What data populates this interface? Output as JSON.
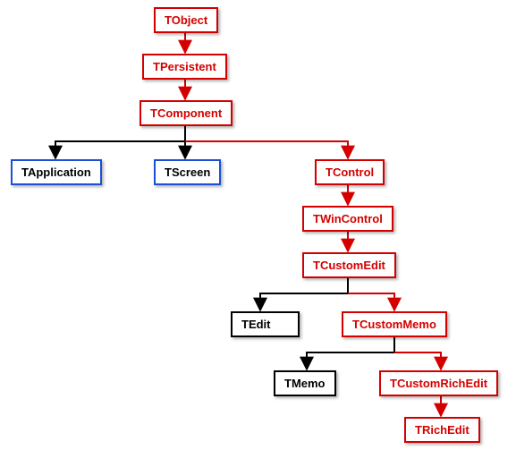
{
  "diagram": {
    "type": "class-hierarchy",
    "root": "TObject",
    "main_path": [
      "TObject",
      "TPersistent",
      "TComponent",
      "TControl",
      "TWinControl",
      "TCustomEdit",
      "TCustomMemo",
      "TCustomRichEdit",
      "TRichEdit"
    ],
    "nodes": {
      "tobject": {
        "label": "TObject",
        "style": "red"
      },
      "tpersistent": {
        "label": "TPersistent",
        "style": "red"
      },
      "tcomponent": {
        "label": "TComponent",
        "style": "red"
      },
      "tapplication": {
        "label": "TApplication",
        "style": "blue"
      },
      "tscreen": {
        "label": "TScreen",
        "style": "blue"
      },
      "tcontrol": {
        "label": "TControl",
        "style": "red"
      },
      "twincontrol": {
        "label": "TWinControl",
        "style": "red"
      },
      "tcustomedit": {
        "label": "TCustomEdit",
        "style": "red"
      },
      "tedit": {
        "label": "TEdit",
        "style": "black"
      },
      "tcustommemo": {
        "label": "TCustomMemo",
        "style": "red"
      },
      "tmemo": {
        "label": "TMemo",
        "style": "black"
      },
      "tcustomrichedit": {
        "label": "TCustomRichEdit",
        "style": "red"
      },
      "trichedit": {
        "label": "TRichEdit",
        "style": "red"
      }
    },
    "edges": [
      {
        "from": "tobject",
        "to": "tpersistent",
        "color": "red"
      },
      {
        "from": "tpersistent",
        "to": "tcomponent",
        "color": "red"
      },
      {
        "from": "tcomponent",
        "to": "tapplication",
        "color": "black"
      },
      {
        "from": "tcomponent",
        "to": "tscreen",
        "color": "black"
      },
      {
        "from": "tcomponent",
        "to": "tcontrol",
        "color": "red"
      },
      {
        "from": "tcontrol",
        "to": "twincontrol",
        "color": "red"
      },
      {
        "from": "twincontrol",
        "to": "tcustomedit",
        "color": "red"
      },
      {
        "from": "tcustomedit",
        "to": "tedit",
        "color": "black"
      },
      {
        "from": "tcustomedit",
        "to": "tcustommemo",
        "color": "red"
      },
      {
        "from": "tcustommemo",
        "to": "tmemo",
        "color": "black"
      },
      {
        "from": "tcustommemo",
        "to": "tcustomrichedit",
        "color": "red"
      },
      {
        "from": "tcustomrichedit",
        "to": "trichedit",
        "color": "red"
      }
    ],
    "colors": {
      "red": "#d40000",
      "black": "#000000"
    }
  }
}
